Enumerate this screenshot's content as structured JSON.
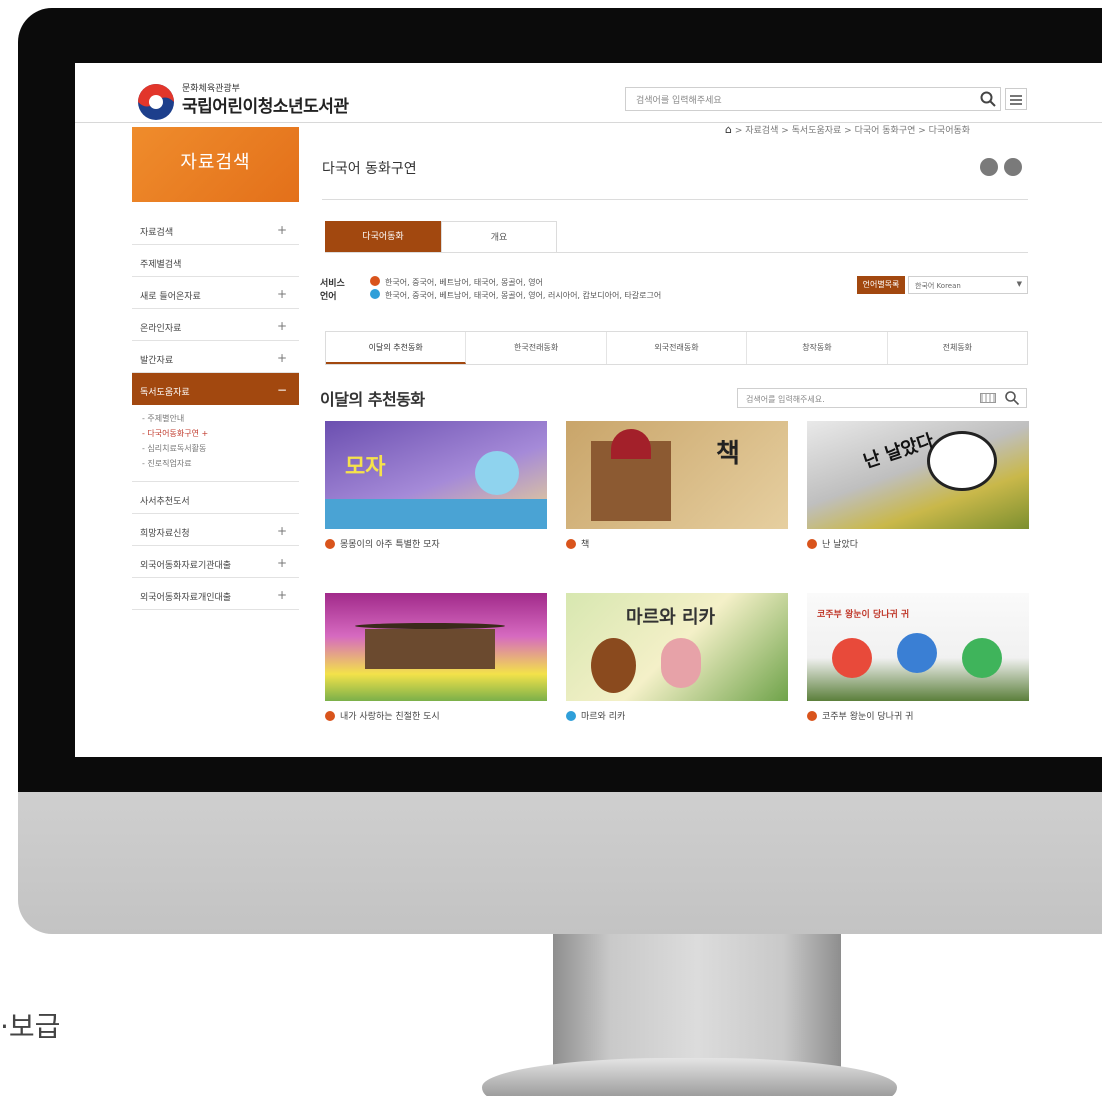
{
  "colors": {
    "brand_orange": "#e8781e",
    "accent_brown": "#a2480f",
    "badge_orange": "#d9541c",
    "badge_blue": "#2f9fd9"
  },
  "header": {
    "ministry": "문화체육관광부",
    "library": "국립어린이청소년도서관",
    "search_placeholder": "검색어를 입력해주세요"
  },
  "breadcrumb": {
    "home_icon": "home-icon",
    "path": " > 자료검색 > 독서도움자료 > 다국어 동화구연 > 다국어동화"
  },
  "sidebar": {
    "title": "자료검색",
    "items": [
      {
        "label": "자료검색",
        "expand": "+"
      },
      {
        "label": "주제별검색",
        "expand": ""
      },
      {
        "label": "새로 들어온자료",
        "expand": "+"
      },
      {
        "label": "온라인자료",
        "expand": "+"
      },
      {
        "label": "발간자료",
        "expand": "+"
      },
      {
        "label": "독서도움자료",
        "expand": "−"
      }
    ],
    "sub_items": [
      "- 주제별안내",
      "- 다국어동화구연  +",
      "- 심리치료독서활동",
      "- 진로직업자료"
    ],
    "items_after": [
      {
        "label": "사서추천도서",
        "expand": ""
      },
      {
        "label": "희망자료신청",
        "expand": "+"
      },
      {
        "label": "외국어동화자료기관대출",
        "expand": "+"
      },
      {
        "label": "외국어동화자료개인대출",
        "expand": "+"
      }
    ]
  },
  "page": {
    "title": "다국어 동화구연"
  },
  "top_tabs": {
    "active": "다국어동화",
    "inactive": "개요"
  },
  "service": {
    "label1": "서비스",
    "label2": "언어",
    "line1": "한국어, 중국어, 베트남어, 태국어, 몽골어, 영어",
    "line2": "한국어, 중국어, 베트남어, 태국어, 몽골어, 영어, 러시아어, 캄보디아어, 타갈로그어",
    "lang_button": "언어별목록",
    "lang_selected": "한국어 Korean"
  },
  "category_tabs": [
    "이달의 추천동화",
    "한국전래동화",
    "외국전래동화",
    "창작동화",
    "전체동화"
  ],
  "section": {
    "title": "이달의 추천동화",
    "search_placeholder": "검색어를 입력해주세요."
  },
  "books": [
    {
      "title": "몽몽이의 아주 특별한 모자",
      "cover_text": "모자"
    },
    {
      "title": "책",
      "cover_text": "책"
    },
    {
      "title": "난 날았다",
      "cover_text": "난 날았다"
    },
    {
      "title": "내가 사랑하는 친절한 도시",
      "cover_text": ""
    },
    {
      "title": "마르와 리카",
      "cover_text": "마르와 리카"
    },
    {
      "title": "코주부 왕눈이 당나귀 귀",
      "cover_text": "코주부 왕눈이 당나귀 귀"
    }
  ],
  "slogan_fragment": "·보급"
}
